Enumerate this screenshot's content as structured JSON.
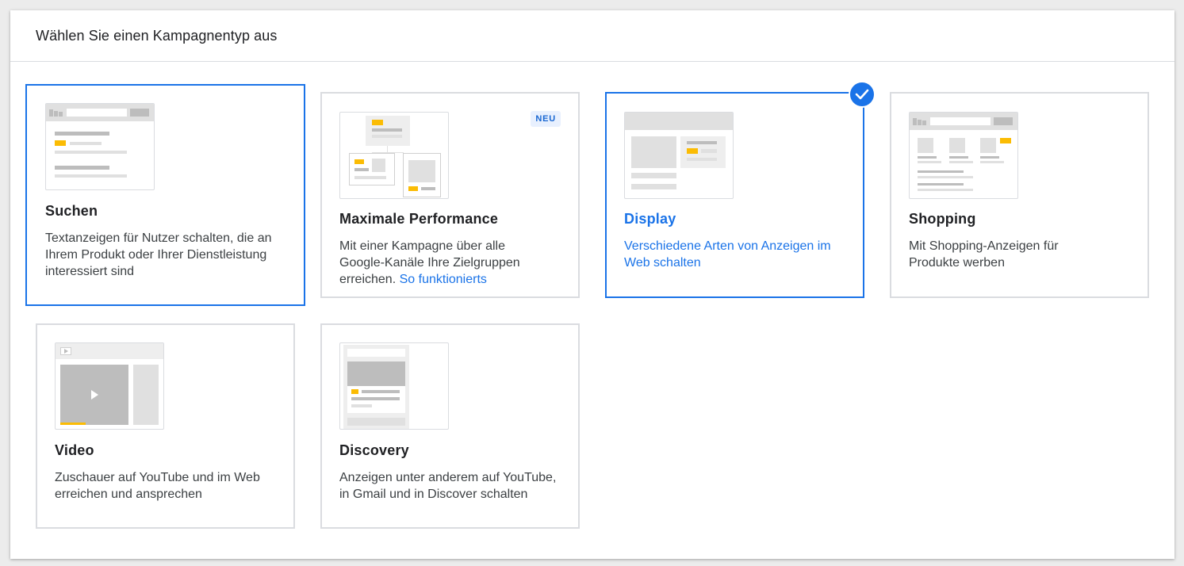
{
  "dialog": {
    "title": "Wählen Sie einen Kampagnentyp aus"
  },
  "colors": {
    "accent": "#1a73e8",
    "thumb_highlight": "#fbbc04",
    "border": "#dadce0"
  },
  "cards": {
    "search": {
      "title": "Suchen",
      "description": "Textanzeigen für Nutzer schalten, die an Ihrem Produkt oder Ihrer Dienstleistung interessiert sind"
    },
    "performance_max": {
      "title": "Maximale Performance",
      "badge": "NEU",
      "description": "Mit einer Kampagne über alle Google-Kanäle Ihre Zielgruppen erreichen.",
      "link": "So funktionierts"
    },
    "display": {
      "title": "Display",
      "description": "Verschiedene Arten von Anzeigen im Web schalten",
      "selected_icon": "check-circle-icon"
    },
    "shopping": {
      "title": "Shopping",
      "description": "Mit Shopping-Anzeigen für Produkte werben"
    },
    "video": {
      "title": "Video",
      "description": "Zuschauer auf YouTube und im Web erreichen und ansprechen"
    },
    "discovery": {
      "title": "Discovery",
      "description": "Anzeigen unter anderem auf YouTube, in Gmail und in Discover schalten"
    }
  }
}
